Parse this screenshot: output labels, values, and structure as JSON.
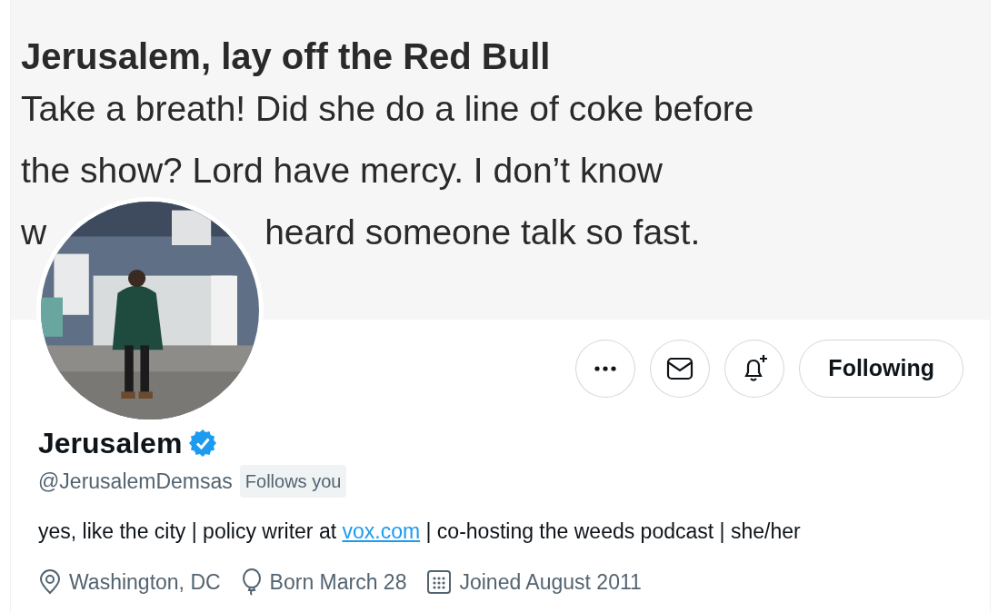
{
  "banner": {
    "title": "Jerusalem, lay off the Red Bull",
    "lines": [
      {
        "fragments": [
          "Take a breath! Did she do a line of coke before"
        ]
      },
      {
        "fragments": [
          "the show? Lord have mercy. I don’t know"
        ]
      },
      {
        "fragments": [
          "w",
          "heard someone talk so fast."
        ]
      }
    ]
  },
  "actions": [
    {
      "kind": "more"
    },
    {
      "kind": "message"
    },
    {
      "kind": "notify"
    },
    {
      "kind": "follow",
      "label": "Following"
    }
  ],
  "profile": {
    "name": "Jerusalem",
    "verified": true,
    "handle": "@JerusalemDemsas",
    "follows_you": "Follows you",
    "bio": [
      {
        "kind": "text",
        "text": "yes, like the city | policy writer at "
      },
      {
        "kind": "link",
        "text": "vox.com"
      },
      {
        "kind": "text",
        "text": " | co-hosting the weeds podcast | she/her"
      }
    ],
    "meta": [
      {
        "kind": "location",
        "text": "Washington, DC"
      },
      {
        "kind": "birthday",
        "text": "Born March 28"
      },
      {
        "kind": "joined",
        "text": "Joined August 2011"
      }
    ]
  }
}
